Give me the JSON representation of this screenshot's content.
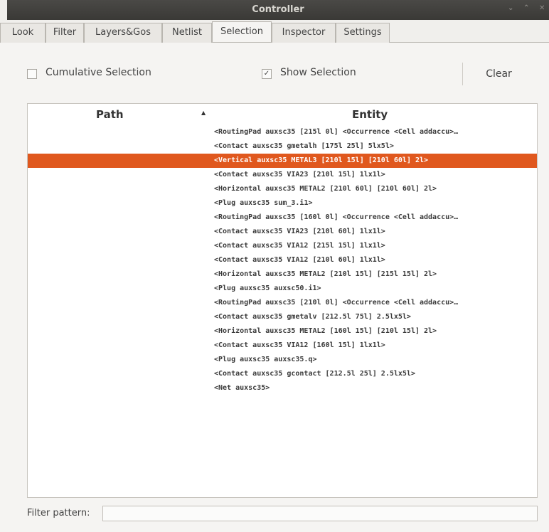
{
  "window": {
    "title": "Controller",
    "controls": [
      "⌄",
      "⌃",
      "✕"
    ]
  },
  "tabs": [
    {
      "label": "Look"
    },
    {
      "label": "Filter"
    },
    {
      "label": "Layers&Gos"
    },
    {
      "label": "Netlist"
    },
    {
      "label": "Selection",
      "active": true
    },
    {
      "label": "Inspector"
    },
    {
      "label": "Settings"
    }
  ],
  "options": {
    "cumulative_label": "Cumulative Selection",
    "cumulative_checked": false,
    "show_label": "Show Selection",
    "show_checked": true,
    "clear_label": "Clear"
  },
  "table": {
    "headers": {
      "path": "Path",
      "entity": "Entity"
    },
    "sort_icon": "sort-ascending-icon",
    "selected_row_color": "#e0581e",
    "rows": [
      {
        "path": "",
        "entity": "<RoutingPad auxsc35 [215l 0l] <Occurrence <Cell addaccu>…"
      },
      {
        "path": "",
        "entity": "<Contact auxsc35 gmetalh [175l 25l] 5lx5l>"
      },
      {
        "path": "",
        "entity": "<Vertical auxsc35 METAL3 [210l 15l] [210l 60l] 2l>",
        "selected": true
      },
      {
        "path": "",
        "entity": "<Contact auxsc35 VIA23 [210l 15l] 1lx1l>"
      },
      {
        "path": "",
        "entity": "<Horizontal auxsc35 METAL2 [210l 60l] [210l 60l] 2l>"
      },
      {
        "path": "",
        "entity": "<Plug auxsc35 sum_3.i1>"
      },
      {
        "path": "",
        "entity": "<RoutingPad auxsc35 [160l 0l] <Occurrence <Cell addaccu>…"
      },
      {
        "path": "",
        "entity": "<Contact auxsc35 VIA23 [210l 60l] 1lx1l>"
      },
      {
        "path": "",
        "entity": "<Contact auxsc35 VIA12 [215l 15l] 1lx1l>"
      },
      {
        "path": "",
        "entity": "<Contact auxsc35 VIA12 [210l 60l] 1lx1l>"
      },
      {
        "path": "",
        "entity": "<Horizontal auxsc35 METAL2 [210l 15l] [215l 15l] 2l>"
      },
      {
        "path": "",
        "entity": "<Plug auxsc35 auxsc50.i1>"
      },
      {
        "path": "",
        "entity": "<RoutingPad auxsc35 [210l 0l] <Occurrence <Cell addaccu>…"
      },
      {
        "path": "",
        "entity": "<Contact auxsc35 gmetalv [212.5l 75l] 2.5lx5l>"
      },
      {
        "path": "",
        "entity": "<Horizontal auxsc35 METAL2 [160l 15l] [210l 15l] 2l>"
      },
      {
        "path": "",
        "entity": "<Contact auxsc35 VIA12 [160l 15l] 1lx1l>"
      },
      {
        "path": "",
        "entity": "<Plug auxsc35 auxsc35.q>"
      },
      {
        "path": "",
        "entity": "<Contact auxsc35 gcontact [212.5l 25l] 2.5lx5l>"
      },
      {
        "path": "",
        "entity": "<Net auxsc35>"
      }
    ]
  },
  "filter": {
    "label": "Filter pattern:",
    "value": ""
  }
}
